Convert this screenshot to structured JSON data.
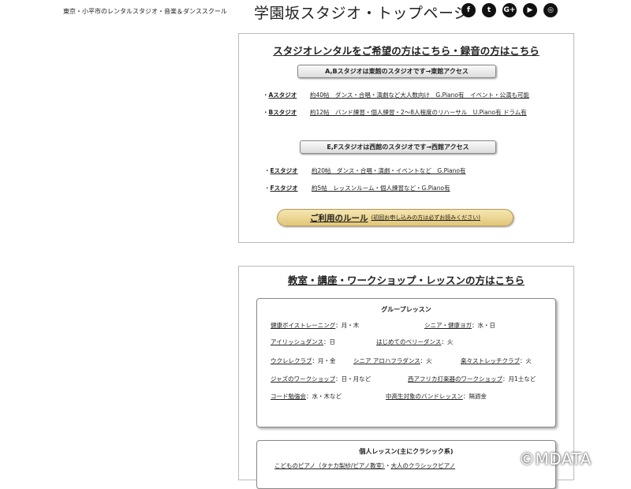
{
  "header": {
    "tagline": "東京・小平市のレンタルスタジオ・音楽＆ダンススクール",
    "title": "学園坂スタジオ・トップページ",
    "social": [
      {
        "icon": "facebook-icon",
        "glyph": "f"
      },
      {
        "icon": "twitter-icon",
        "glyph": "t"
      },
      {
        "icon": "google-plus-icon",
        "glyph": "G+"
      },
      {
        "icon": "youtube-icon",
        "glyph": "▶"
      },
      {
        "icon": "instagram-icon",
        "glyph": "◎"
      }
    ]
  },
  "rental": {
    "heading": "スタジオレンタルをご希望の方はこちら・録音の方はこちら",
    "east_button": "A,Bスタジオは東館のスタジオです→東館アクセス",
    "studios_east": [
      {
        "name": "Aスタジオ",
        "desc": "約40帖　ダンス・合唱・演劇など大人数向け　G.Piano有　イベント・公演も可能"
      },
      {
        "name": "Bスタジオ",
        "desc": "約12帖　バンド練習・個人練習・2〜8人程度のリハーサル　U.Piano有 ドラム有"
      }
    ],
    "west_button": "E,Fスタジオは西館のスタジオです→西館アクセス",
    "studios_west": [
      {
        "name": "Eスタジオ",
        "desc": "約20帖　ダンス・合唱・演劇・イベントなど　G.Piano有"
      },
      {
        "name": "Fスタジオ",
        "desc": "約5帖　レッスンルーム・個人練習など・G.Piano有"
      }
    ],
    "rules_label": "ご利用のルール",
    "rules_note": "(初回お申し込みの方は必ずお読みください)"
  },
  "lessons": {
    "heading": "教室・講座・ワークショップ・レッスンの方はこちら",
    "group_title": "グループレッスン",
    "group_rows": [
      [
        {
          "name": "健康ボイストレーニング",
          "days": "：月・木"
        },
        {
          "name": "シニア・健康ヨガ",
          "days": "：水・日"
        }
      ],
      [
        {
          "name": "アイリッシュダンス",
          "days": "：日"
        },
        {
          "name": "はじめてのベリーダンス",
          "days": "：火"
        }
      ],
      [
        {
          "name": "ウクレレクラブ",
          "days": "：月・金"
        },
        {
          "name": "シニア アロハフラダンス",
          "days": "：火"
        },
        {
          "name": "楽々ストレッチクラブ",
          "days": "：火"
        }
      ],
      [
        {
          "name": "ジャズのワークショップ",
          "days": "：日・月など"
        },
        {
          "name": "西アフリカ打楽器のワークショップ",
          "days": "：月1土など"
        }
      ],
      [
        {
          "name": "コード勉強会",
          "days": "：水・木など"
        },
        {
          "name": "中高生対象のバンドレッスン",
          "days": "：隔週金"
        }
      ]
    ],
    "private_title": "個人レッスン(主にクラシック系)",
    "private_items": [
      {
        "name": "こどものピアノ（タナカ梨紗/ピアノ教室）",
        "sep": "・"
      },
      {
        "name": "大人のクラシックピアノ",
        "sep": ""
      }
    ]
  },
  "watermark": "©MDATA"
}
